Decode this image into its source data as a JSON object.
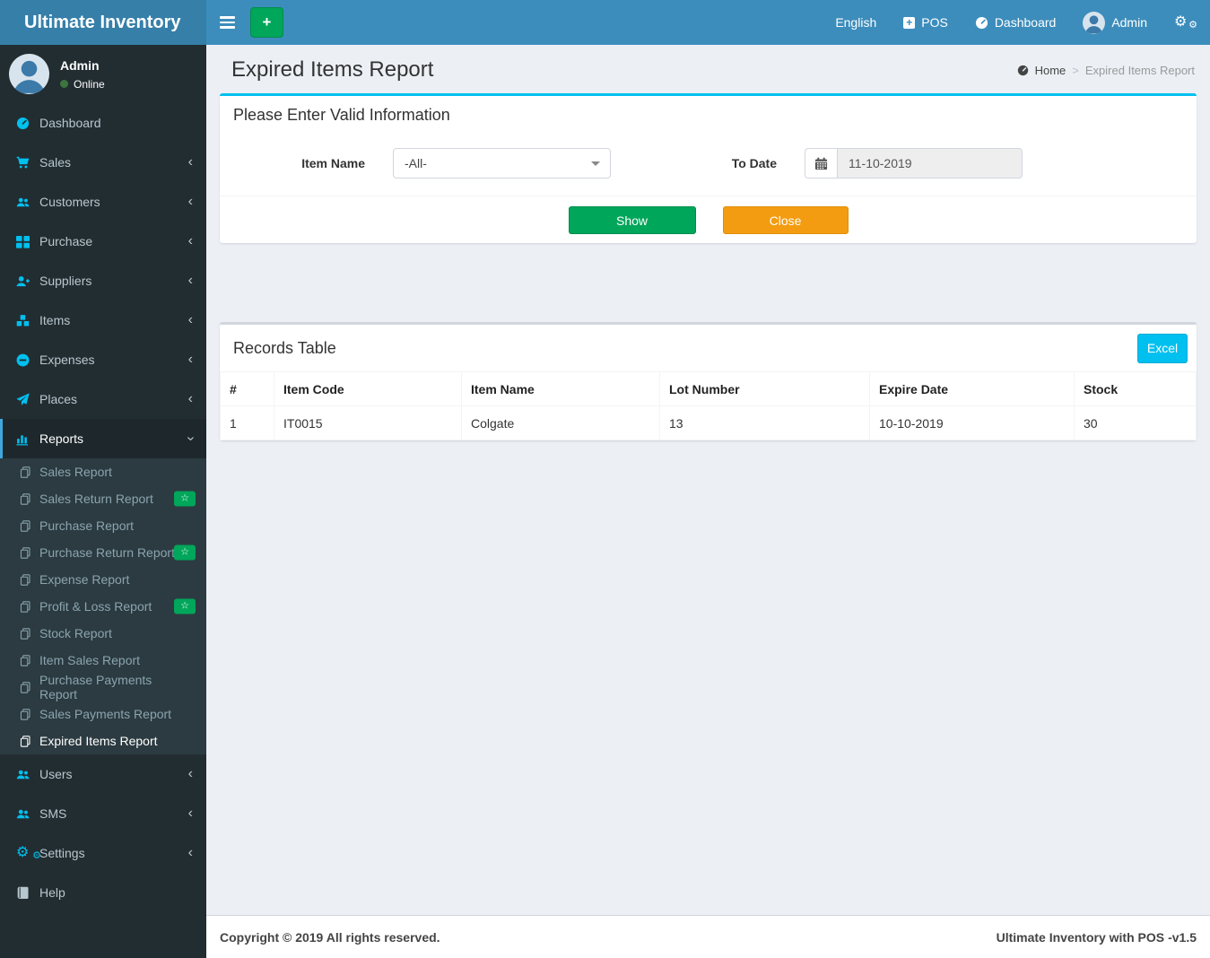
{
  "colors": {
    "navbar_bg": "#3c8dbc",
    "logo_bg": "#367fa9",
    "sidebar_bg": "#222d32",
    "submenu_bg": "#2c3b41",
    "sidebar_icon": "#00c0ef",
    "active_item_border": "#3fa7dc",
    "filter_panel_top_border": "#00c0ef",
    "green_button": "#00a65a",
    "orange_button": "#f39c12",
    "excel_button": "#00c0ef",
    "badge_green": "#00a65a",
    "content_bg": "#ecf0f5",
    "online_dot": "#3c763d"
  },
  "icons": {
    "star": "☆",
    "gears": "⚙",
    "plus": "+",
    "separator": ">"
  },
  "logo": {
    "title": "Ultimate Inventory"
  },
  "navbar": {
    "english": "English",
    "pos": "POS",
    "dashboard": "Dashboard",
    "user": "Admin"
  },
  "sidebar": {
    "user": {
      "name": "Admin",
      "status": "Online"
    },
    "menu": [
      {
        "label": "Dashboard"
      },
      {
        "label": "Sales"
      },
      {
        "label": "Customers"
      },
      {
        "label": "Purchase"
      },
      {
        "label": "Suppliers"
      },
      {
        "label": "Items"
      },
      {
        "label": "Expenses"
      },
      {
        "label": "Places"
      }
    ],
    "reports": {
      "label": "Reports",
      "submenu": [
        {
          "label": "Sales Report"
        },
        {
          "label": "Sales Return Report"
        },
        {
          "label": "Purchase Report"
        },
        {
          "label": "Purchase Return Report"
        },
        {
          "label": "Expense Report"
        },
        {
          "label": "Profit & Loss Report"
        },
        {
          "label": "Stock Report"
        },
        {
          "label": "Item Sales Report"
        },
        {
          "label": "Purchase Payments Report"
        },
        {
          "label": "Sales Payments Report"
        },
        {
          "label": "Expired Items Report"
        }
      ]
    },
    "menu_bottom": [
      {
        "label": "Users"
      },
      {
        "label": "SMS"
      },
      {
        "label": "Settings"
      },
      {
        "label": "Help"
      }
    ]
  },
  "page": {
    "title": "Expired Items Report",
    "breadcrumb": {
      "home": "Home",
      "current": "Expired Items Report"
    }
  },
  "filter_panel": {
    "header": "Please Enter Valid Information",
    "item_name_label": "Item Name",
    "item_name_value": "-All-",
    "to_date_label": "To Date",
    "to_date_value": "11-10-2019",
    "show_button": "Show",
    "close_button": "Close"
  },
  "records_panel": {
    "header": "Records Table",
    "excel_button": "Excel",
    "columns": [
      "#",
      "Item Code",
      "Item Name",
      "Lot Number",
      "Expire Date",
      "Stock"
    ],
    "rows": [
      [
        "1",
        "IT0015",
        "Colgate",
        "13",
        "10-10-2019",
        "30"
      ]
    ]
  },
  "footer": {
    "left": "Copyright © 2019 All rights reserved.",
    "right_brand": "Ultimate Inventory with POS",
    "right_version": "-v1.5"
  }
}
